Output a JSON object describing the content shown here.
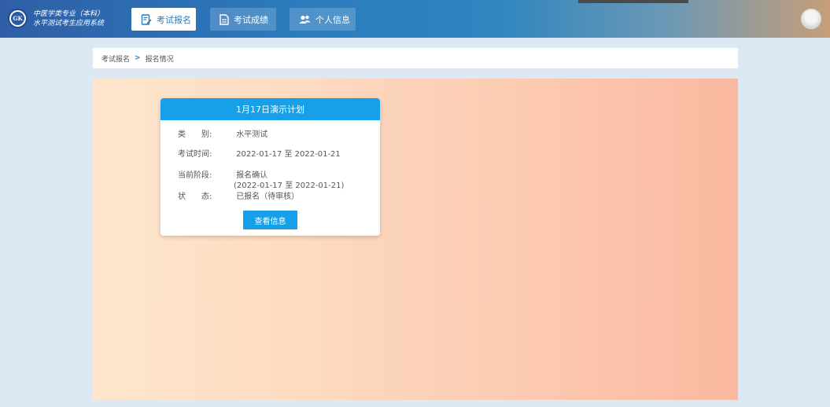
{
  "app": {
    "brand_line1": "中医学类专业（本科）",
    "brand_line2": "水平测试考生应用系统",
    "logo_text": "GK"
  },
  "nav": [
    {
      "label": "考试报名",
      "active": true,
      "icon": "document-edit-icon"
    },
    {
      "label": "考试成绩",
      "active": false,
      "icon": "document-icon"
    },
    {
      "label": "个人信息",
      "active": false,
      "icon": "users-icon"
    }
  ],
  "breadcrumb": {
    "root": "考试报名",
    "separator": ">",
    "current": "报名情况"
  },
  "card": {
    "title": "1月17日演示计划",
    "fields": [
      {
        "key": "类　　别:",
        "value": "水平测试"
      },
      {
        "key": "考试时间:",
        "value": "2022-01-17 至 2022-01-21"
      },
      {
        "key": "当前阶段:",
        "value": "报名确认",
        "value2": "(2022-01-17 至 2022-01-21)"
      },
      {
        "key": "状　　态:",
        "value": "已报名（待审核）"
      }
    ],
    "button_label": "查看信息"
  },
  "colors": {
    "accent": "#17a0e8",
    "header_start": "#2f5ea6",
    "header_end": "#c79e78"
  }
}
